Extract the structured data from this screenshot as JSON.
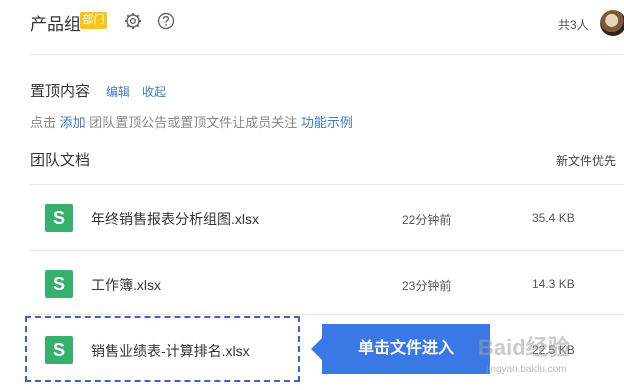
{
  "header": {
    "title": "产品组",
    "badge": "部门",
    "member_count": "共3人"
  },
  "pinned": {
    "title": "置顶内容",
    "edit_label": "编辑",
    "collapse_label": "收起",
    "hint_prefix": "点击",
    "hint_add": "添加",
    "hint_middle": "团队置顶公告或置顶文件让成员关注",
    "hint_example": "功能示例"
  },
  "team_docs": {
    "title": "团队文档",
    "sort_label": "新文件优先",
    "files": [
      {
        "name": "年终销售报表分析组图.xlsx",
        "time": "22分钟前",
        "size": "35.4 KB",
        "icon": "S"
      },
      {
        "name": "工作簿.xlsx",
        "time": "23分钟前",
        "size": "14.3 KB",
        "icon": "S"
      },
      {
        "name": "销售业绩表-计算排名.xlsx",
        "time": "",
        "size": "22.5 KB",
        "icon": "S"
      }
    ]
  },
  "callout": {
    "text": "单击文件进入"
  },
  "watermark": {
    "main": "Baid经验",
    "sub": "jingyan.baidu.com"
  },
  "colors": {
    "accent": "#3b7bd6",
    "badge": "#f5c518",
    "file_icon": "#38b06d",
    "callout": "#3a78e6"
  }
}
